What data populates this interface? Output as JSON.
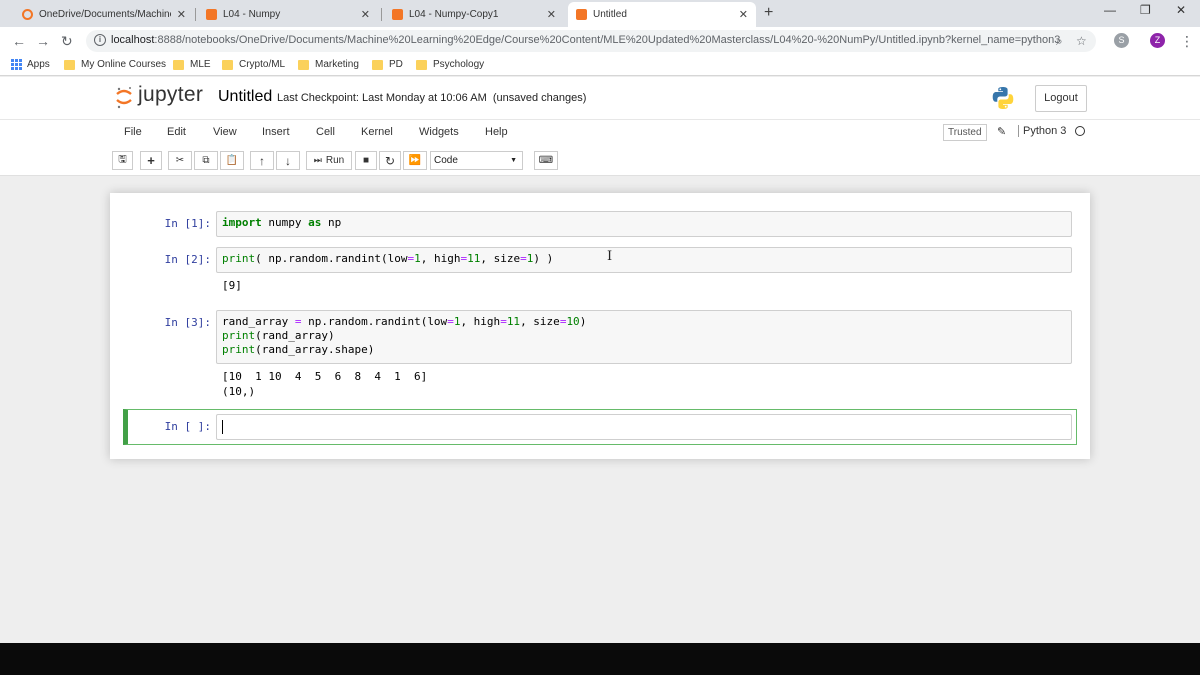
{
  "browser": {
    "tabs": [
      {
        "title": "OneDrive/Documents/Machine L",
        "active": false,
        "icon": "jupyter-circle-icon"
      },
      {
        "title": "L04 - Numpy",
        "active": false,
        "icon": "notebook-icon"
      },
      {
        "title": "L04 - Numpy-Copy1",
        "active": false,
        "icon": "notebook-icon"
      },
      {
        "title": "Untitled",
        "active": true,
        "icon": "notebook-icon"
      }
    ],
    "url_host": "localhost",
    "url_rest": ":8888/notebooks/OneDrive/Documents/Machine%20Learning%20Edge/Course%20Content/MLE%20Updated%20Masterclass/L04%20-%20NumPy/Untitled.ipynb?kernel_name=python3",
    "profile_letter": "Z",
    "bookmarks": [
      "Apps",
      "My Online Courses",
      "MLE",
      "Crypto/ML",
      "Marketing",
      "PD",
      "Psychology"
    ]
  },
  "jupyter": {
    "brand": "jupyter",
    "notebook_name": "Untitled",
    "checkpoint": "Last Checkpoint: Last Monday at 10:06 AM",
    "unsaved": "(unsaved changes)",
    "logout": "Logout",
    "menu": [
      "File",
      "Edit",
      "View",
      "Insert",
      "Cell",
      "Kernel",
      "Widgets",
      "Help"
    ],
    "trusted": "Trusted",
    "kernel_name": "Python 3",
    "toolbar": {
      "run_label": "Run",
      "cell_type": "Code"
    }
  },
  "cells": [
    {
      "prompt": "In [1]:",
      "code_lines": [
        "import numpy as np"
      ],
      "output_lines": []
    },
    {
      "prompt": "In [2]:",
      "code_lines": [
        "print( np.random.randint(low=1, high=11, size=1) )"
      ],
      "output_lines": [
        "[9]"
      ]
    },
    {
      "prompt": "In [3]:",
      "code_lines": [
        "rand_array = np.random.randint(low=1, high=11, size=10)",
        "print(rand_array)",
        "print(rand_array.shape)"
      ],
      "output_lines": [
        "[10  1 10  4  5  6  8  4  1  6]",
        "(10,)"
      ]
    },
    {
      "prompt": "In [ ]:",
      "code_lines": [
        ""
      ],
      "output_lines": []
    }
  ],
  "colors": {
    "prompt": "#303f9f",
    "keyword": "#008000",
    "selected_border": "#42a047",
    "jupyter_orange": "#f37626"
  }
}
